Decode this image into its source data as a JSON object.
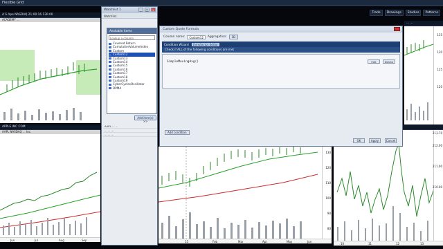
{
  "window": {
    "title": "Flexible Grid",
    "top_buttons": [
      "Trade",
      "Drawings",
      "Studies",
      "Patterns"
    ]
  },
  "panels": {
    "top_left": {
      "header": "A S Ape  NASDAQ  21:00:16  130.00",
      "subheader": "ACADEMY ... "
    },
    "bottom_left": {
      "header": "APPLE INC COM",
      "subheader": "AAPL  NASDAQ  ...  Inc.",
      "price_ticks": [
        "140",
        "135",
        "130",
        "125",
        "120"
      ],
      "time_ticks": [
        "Jun",
        "Jul",
        "Aug",
        "Sep"
      ]
    },
    "top_right": {
      "header": "...  ...",
      "price_ticks": [
        "135",
        "130",
        "125",
        "120"
      ],
      "time_ticks": [
        "Mar",
        "Apr"
      ]
    },
    "bottom_right": {
      "header": "APPLE INC COM  212.70",
      "price_ticks": [
        "213.70",
        "212.00",
        "211.00",
        "210.00"
      ],
      "time_ticks": [
        "10",
        "11",
        "12",
        "13"
      ]
    },
    "bottom_center": {
      "price_ticks": [
        "130",
        "120",
        "110",
        "100",
        "90",
        "80"
      ],
      "time_ticks": [
        "15",
        "Feb",
        "Mar",
        "Apr",
        "May",
        "Jun"
      ]
    }
  },
  "watchlist": {
    "title": "Watchlist 1",
    "tab": "Watchlist",
    "controls": [
      "_",
      "□",
      "×"
    ],
    "available_items": {
      "header": "Available items",
      "lookup_placeholder": "Lookup a column",
      "items": [
        "Covered Return",
        "CumulativeVolumeIndex",
        "Custom",
        "Custom12",
        "Custom13",
        "Custom14",
        "Custom15",
        "Custom16",
        "Custom17",
        "Custom18",
        "Custom19",
        "CyberCyclesOscillator",
        "DPMA"
      ],
      "selected_index": 3
    },
    "add_button": "Add item(s) >>",
    "rows": [
      "AAPL   ...   ...",
      "...   ...   ...",
      "...   ...   ..."
    ]
  },
  "dialog": {
    "title": "Custom Quote Formula",
    "column_name_label": "Column name:",
    "column_name_value": "Custom12",
    "aggregation_label": "Aggregation:",
    "aggregation_value": "1D",
    "wizard_tab": "Condition Wizard",
    "editor_tab": "thinkScript Editor",
    "check_text": "Check if ALL of the following conditions are met",
    "check_select": "ALL",
    "code": "SimpleMovingAvg()",
    "edit_button": "Edit",
    "delete_button": "Delete",
    "add_condition": "Add condition",
    "ok": "OK",
    "apply": "Apply",
    "cancel": "Cancel"
  },
  "chart_colors": {
    "up": "#2a8a2a",
    "down": "#c03030",
    "sma": "#27a027",
    "sma2": "#cc2a2a",
    "volume": "#9aa0a8"
  }
}
